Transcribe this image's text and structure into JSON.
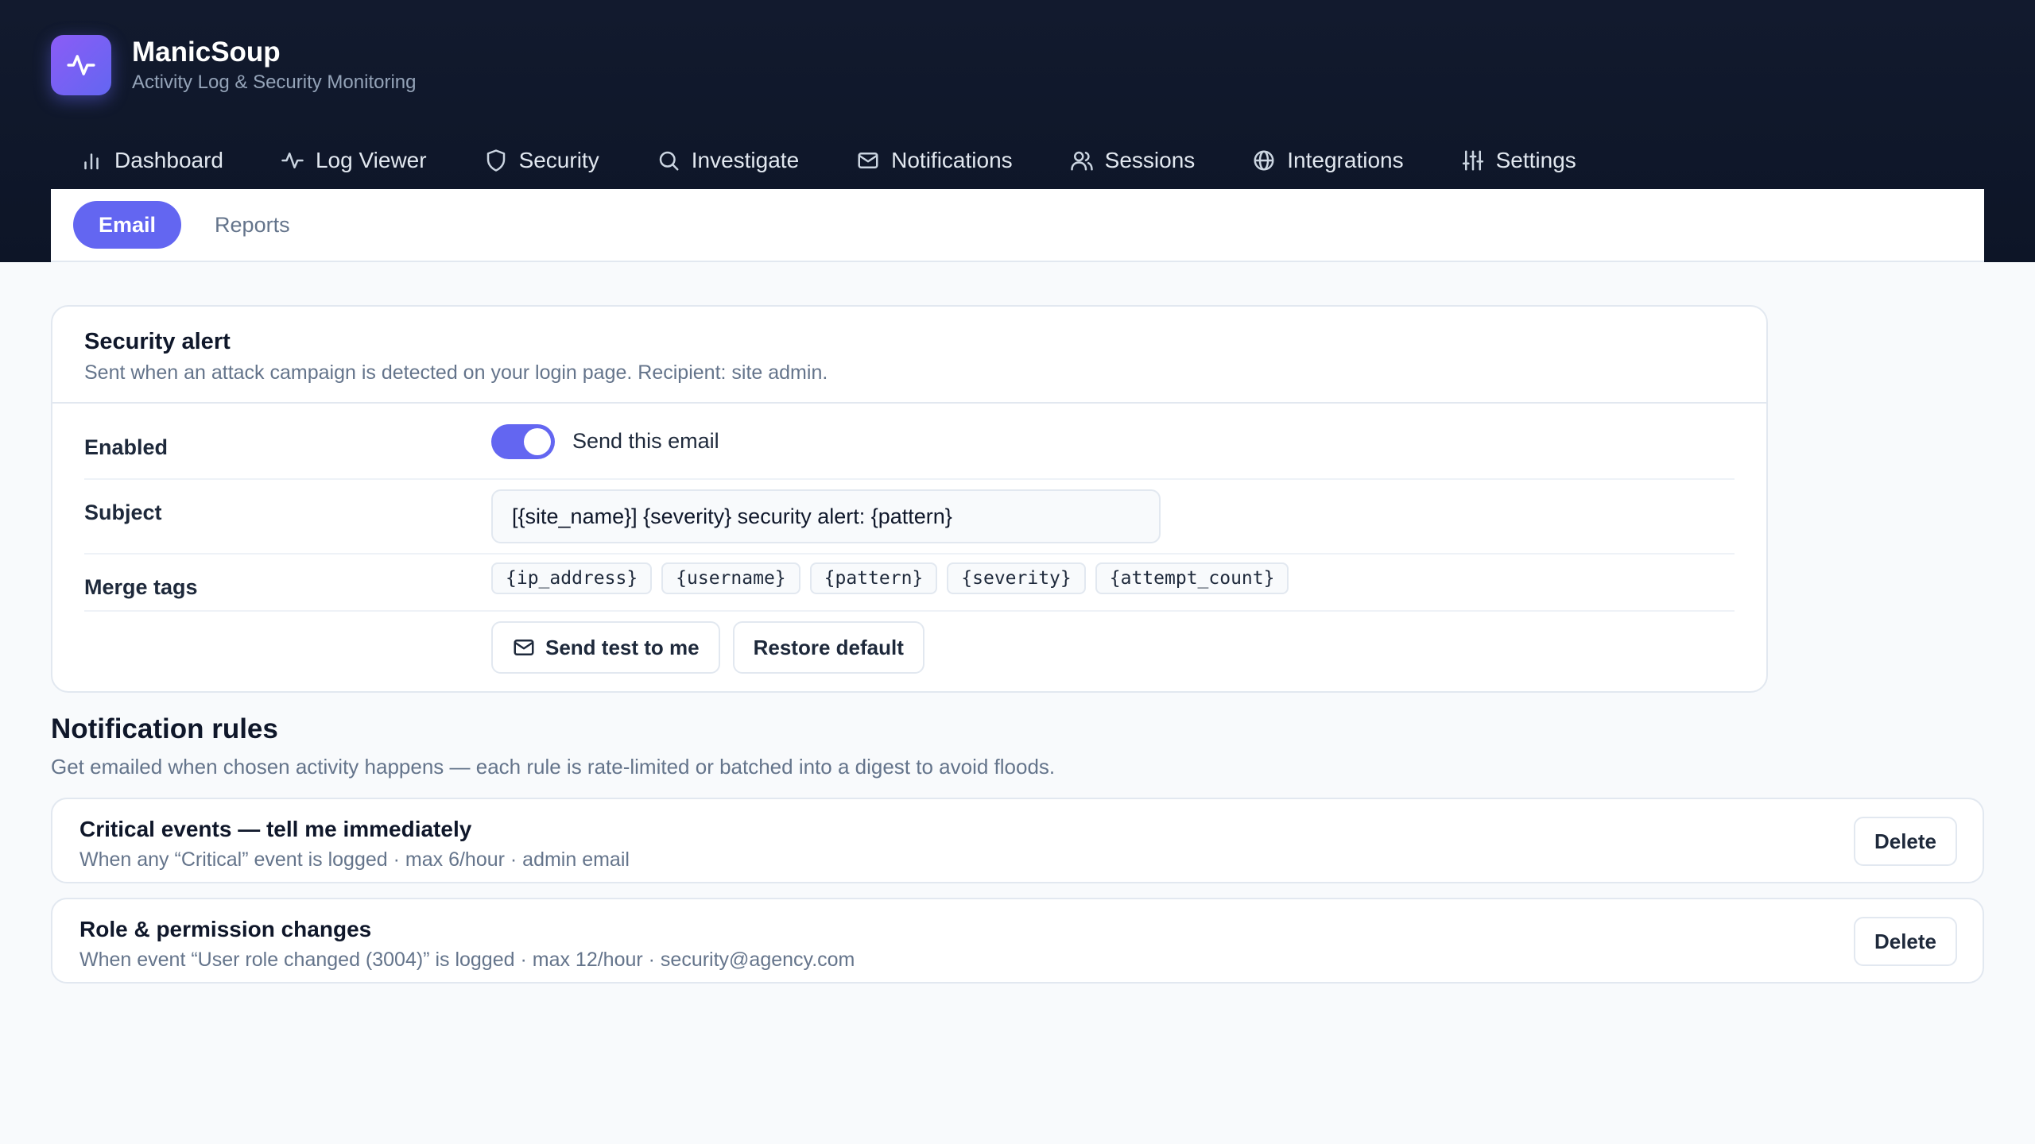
{
  "app": {
    "name": "ManicSoup",
    "subtitle": "Activity Log & Security Monitoring",
    "logo_icon": "activity-pulse-icon",
    "accent": "#6366f1"
  },
  "nav": {
    "items": [
      {
        "label": "Dashboard",
        "icon": "bar-chart-icon"
      },
      {
        "label": "Log Viewer",
        "icon": "activity-icon"
      },
      {
        "label": "Security",
        "icon": "shield-icon"
      },
      {
        "label": "Investigate",
        "icon": "search-icon"
      },
      {
        "label": "Notifications",
        "icon": "mail-icon",
        "active": true
      },
      {
        "label": "Sessions",
        "icon": "users-icon"
      },
      {
        "label": "Integrations",
        "icon": "globe-icon"
      },
      {
        "label": "Settings",
        "icon": "sliders-icon"
      }
    ]
  },
  "subnav": {
    "tabs": [
      {
        "label": "Email",
        "active": true
      },
      {
        "label": "Reports",
        "active": false
      }
    ]
  },
  "email_card": {
    "title": "Security alert",
    "description": "Sent when an attack campaign is detected on your login page. Recipient: site admin.",
    "enabled": {
      "label": "Enabled",
      "toggle_on": true,
      "toggle_label": "Send this email"
    },
    "subject": {
      "label": "Subject",
      "value": "[{site_name}] {severity} security alert: {pattern}"
    },
    "merge_tags": {
      "label": "Merge tags",
      "tags": [
        "{ip_address}",
        "{username}",
        "{pattern}",
        "{severity}",
        "{attempt_count}"
      ]
    },
    "actions": {
      "send_test": "Send test to me",
      "restore_default": "Restore default"
    }
  },
  "rules": {
    "title": "Notification rules",
    "description": "Get emailed when chosen activity happens — each rule is rate-limited or batched into a digest to avoid floods.",
    "items": [
      {
        "title": "Critical events — tell me immediately",
        "description": "When any “Critical” event is logged · max 6/hour · admin email",
        "delete_label": "Delete"
      },
      {
        "title": "Role & permission changes",
        "description": "When event “User role changed (3004)” is logged · max 12/hour · security@agency.com",
        "delete_label": "Delete"
      }
    ]
  }
}
